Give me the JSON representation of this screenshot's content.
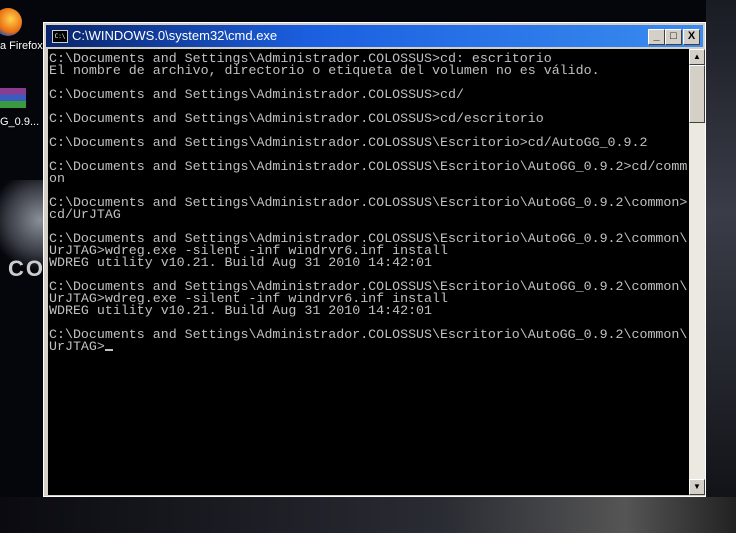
{
  "desktop": {
    "icons": [
      {
        "label": "a Firefox"
      },
      {
        "label": "G_0.9..."
      }
    ],
    "logo_text": "CO"
  },
  "window": {
    "title": "C:\\WINDOWS.0\\system32\\cmd.exe",
    "icon_text": "C:\\",
    "minimize": "_",
    "maximize": "□",
    "close": "X"
  },
  "console": {
    "lines": [
      "C:\\Documents and Settings\\Administrador.COLOSSUS>cd: escritorio",
      "El nombre de archivo, directorio o etiqueta del volumen no es válido.",
      "",
      "C:\\Documents and Settings\\Administrador.COLOSSUS>cd/",
      "",
      "C:\\Documents and Settings\\Administrador.COLOSSUS>cd/escritorio",
      "",
      "C:\\Documents and Settings\\Administrador.COLOSSUS\\Escritorio>cd/AutoGG_0.9.2",
      "",
      "C:\\Documents and Settings\\Administrador.COLOSSUS\\Escritorio\\AutoGG_0.9.2>cd/comm",
      "on",
      "",
      "C:\\Documents and Settings\\Administrador.COLOSSUS\\Escritorio\\AutoGG_0.9.2\\common>",
      "cd/UrJTAG",
      "",
      "C:\\Documents and Settings\\Administrador.COLOSSUS\\Escritorio\\AutoGG_0.9.2\\common\\",
      "UrJTAG>wdreg.exe -silent -inf windrvr6.inf install",
      "WDREG utility v10.21. Build Aug 31 2010 14:42:01",
      "",
      "C:\\Documents and Settings\\Administrador.COLOSSUS\\Escritorio\\AutoGG_0.9.2\\common\\",
      "UrJTAG>wdreg.exe -silent -inf windrvr6.inf install",
      "WDREG utility v10.21. Build Aug 31 2010 14:42:01",
      "",
      "C:\\Documents and Settings\\Administrador.COLOSSUS\\Escritorio\\AutoGG_0.9.2\\common\\"
    ],
    "prompt": "UrJTAG>"
  }
}
